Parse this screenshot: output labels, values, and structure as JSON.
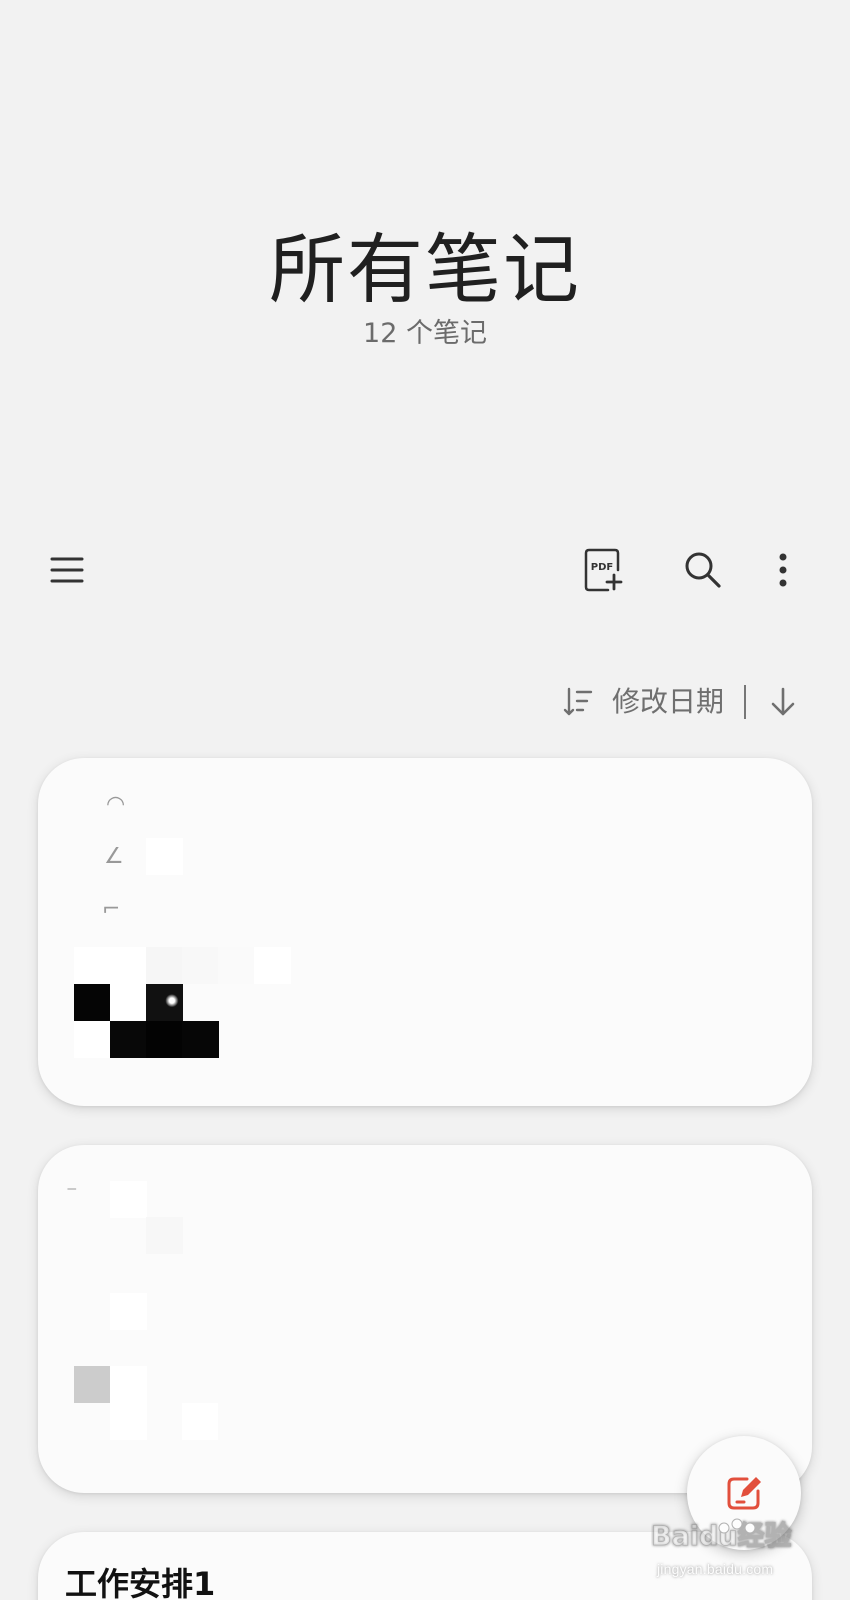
{
  "header": {
    "title": "所有笔记",
    "subtitle": "12 个笔记"
  },
  "toolbar": {
    "menu_icon": "menu-icon",
    "pdf_icon": "pdf-import-icon",
    "pdf_text": "PDF",
    "search_icon": "search-icon",
    "more_icon": "more-vertical-icon"
  },
  "sort": {
    "icon": "sort-icon",
    "label": "修改日期",
    "direction_icon": "arrow-down-icon"
  },
  "notes": [
    {
      "title": "",
      "content_state": "redacted"
    },
    {
      "title": "",
      "content_state": "redacted"
    },
    {
      "title": "工作安排1"
    }
  ],
  "fab": {
    "icon": "compose-icon",
    "accent_color": "#e24f3c"
  },
  "watermark": {
    "brand": "Baidu经验",
    "url": "jingyan.baidu.com"
  },
  "colors": {
    "background": "#f2f2f2",
    "card_background": "#fbfbfb",
    "text_primary": "#202020",
    "text_secondary": "#6f6f6f",
    "accent": "#e24f3c"
  }
}
